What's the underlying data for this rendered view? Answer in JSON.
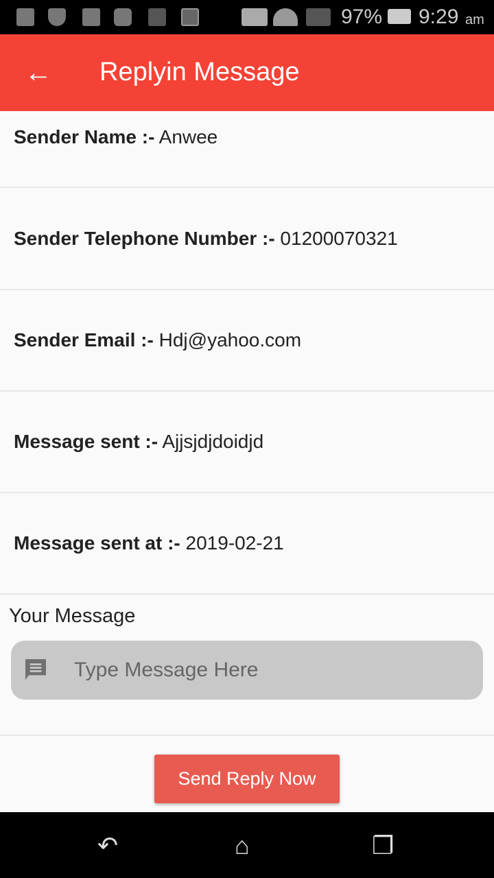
{
  "status_bar": {
    "battery": "97%",
    "time": "9:29",
    "ampm": "am"
  },
  "app_bar": {
    "title": "Replyin Message"
  },
  "details": [
    {
      "label": "Sender Name :-",
      "value": "Anwee"
    },
    {
      "label": "Sender Telephone Number :-",
      "value": "01200070321"
    },
    {
      "label": "Sender Email :-",
      "value": "Hdj@yahoo.com"
    },
    {
      "label": "Message sent :-",
      "value": "Ajjsjdjdoidjd"
    },
    {
      "label": "Message sent at :-",
      "value": "2019-02-21"
    }
  ],
  "reply": {
    "label": "Your Message",
    "placeholder": "Type Message Here",
    "button": "Send Reply Now"
  },
  "colors": {
    "primary": "#f44336",
    "button": "#e85b50"
  }
}
